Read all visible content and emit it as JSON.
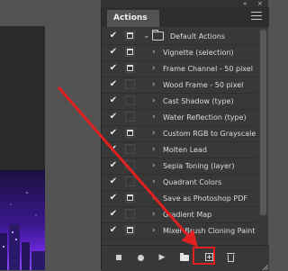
{
  "panel": {
    "tab_label": "Actions",
    "collapse_glyph": "«",
    "close_glyph": "×",
    "menu_icon": "hamburger-menu-icon"
  },
  "actions": {
    "rows": [
      {
        "label": "Default Actions",
        "checked": true,
        "dialog": true,
        "is_set": true,
        "expanded": true
      },
      {
        "label": "Vignette (selection)",
        "checked": true,
        "dialog": true,
        "is_set": false
      },
      {
        "label": "Frame Channel - 50 pixel",
        "checked": true,
        "dialog": true,
        "is_set": false
      },
      {
        "label": "Wood Frame - 50 pixel",
        "checked": true,
        "dialog": false,
        "is_set": false
      },
      {
        "label": "Cast Shadow (type)",
        "checked": true,
        "dialog": false,
        "is_set": false
      },
      {
        "label": "Water Reflection (type)",
        "checked": true,
        "dialog": false,
        "is_set": false
      },
      {
        "label": "Custom RGB to Grayscale",
        "checked": true,
        "dialog": true,
        "is_set": false
      },
      {
        "label": "Molten Lead",
        "checked": true,
        "dialog": false,
        "is_set": false
      },
      {
        "label": "Sepia Toning (layer)",
        "checked": true,
        "dialog": false,
        "is_set": false
      },
      {
        "label": "Quadrant Colors",
        "checked": true,
        "dialog": false,
        "is_set": false
      },
      {
        "label": "Save as Photoshop PDF",
        "checked": true,
        "dialog": true,
        "is_set": false
      },
      {
        "label": "Gradient Map",
        "checked": true,
        "dialog": false,
        "is_set": false
      },
      {
        "label": "Mixer Brush Cloning Paint ...",
        "checked": true,
        "dialog": true,
        "is_set": false
      }
    ]
  },
  "bottom_bar": {
    "buttons": [
      "stop-playing-recording",
      "begin-recording",
      "play-selection",
      "create-new-set",
      "create-new-action",
      "delete"
    ],
    "highlighted": "create-new-set"
  },
  "colors": {
    "panel_bg": "#383838",
    "annotation_red": "#e02020"
  }
}
